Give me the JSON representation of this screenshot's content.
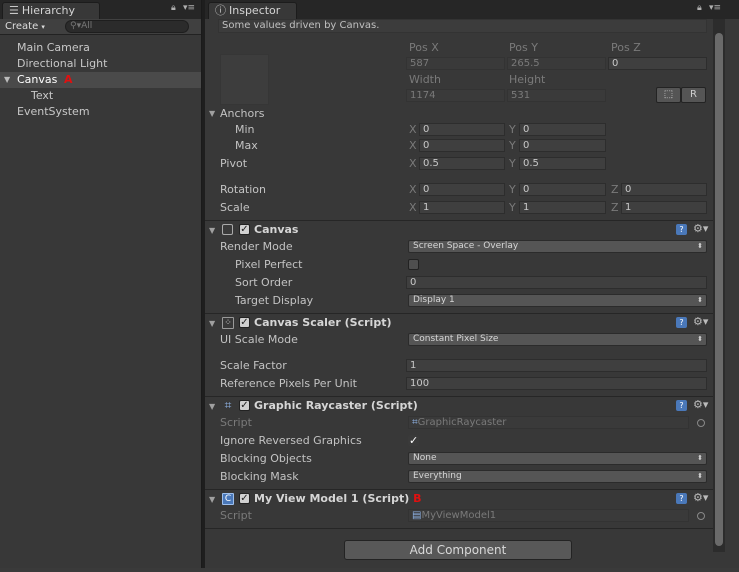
{
  "hierarchy": {
    "tab_label": "Hierarchy",
    "create_label": "Create",
    "search_placeholder": "All",
    "items": [
      {
        "label": "Main Camera"
      },
      {
        "label": "Directional Light"
      },
      {
        "label": "Canvas",
        "annotation": "A"
      },
      {
        "label": "Text"
      },
      {
        "label": "EventSystem"
      }
    ]
  },
  "inspector": {
    "tab_label": "Inspector",
    "driven_note": "Some values driven by Canvas.",
    "rect": {
      "pos_x_label": "Pos X",
      "pos_y_label": "Pos Y",
      "pos_z_label": "Pos Z",
      "pos_x": "587",
      "pos_y": "265.5",
      "pos_z": "0",
      "width_label": "Width",
      "height_label": "Height",
      "width": "1174",
      "height": "531",
      "r_button": "R",
      "anchors_label": "Anchors",
      "min_label": "Min",
      "max_label": "Max",
      "min_x": "0",
      "min_y": "0",
      "max_x": "0",
      "max_y": "0",
      "pivot_label": "Pivot",
      "pivot_x": "0.5",
      "pivot_y": "0.5",
      "rotation_label": "Rotation",
      "rot_x": "0",
      "rot_y": "0",
      "rot_z": "0",
      "scale_label": "Scale",
      "scale_x": "1",
      "scale_y": "1",
      "scale_z": "1",
      "x": "X",
      "y": "Y",
      "z": "Z"
    },
    "canvas": {
      "title": "Canvas",
      "render_mode_label": "Render Mode",
      "render_mode": "Screen Space - Overlay",
      "pixel_perfect_label": "Pixel Perfect",
      "sort_order_label": "Sort Order",
      "sort_order": "0",
      "target_display_label": "Target Display",
      "target_display": "Display 1"
    },
    "scaler": {
      "title": "Canvas Scaler (Script)",
      "ui_scale_mode_label": "UI Scale Mode",
      "ui_scale_mode": "Constant Pixel Size",
      "scale_factor_label": "Scale Factor",
      "scale_factor": "1",
      "ref_ppu_label": "Reference Pixels Per Unit",
      "ref_ppu": "100"
    },
    "raycaster": {
      "title": "Graphic Raycaster (Script)",
      "script_label": "Script",
      "script": "GraphicRaycaster",
      "ignore_reversed_label": "Ignore Reversed Graphics",
      "blocking_objects_label": "Blocking Objects",
      "blocking_objects": "None",
      "blocking_mask_label": "Blocking Mask",
      "blocking_mask": "Everything"
    },
    "viewmodel": {
      "title": "My View Model 1 (Script)",
      "annotation": "B",
      "script_label": "Script",
      "script": "MyViewModel1"
    },
    "add_component": "Add Component"
  }
}
